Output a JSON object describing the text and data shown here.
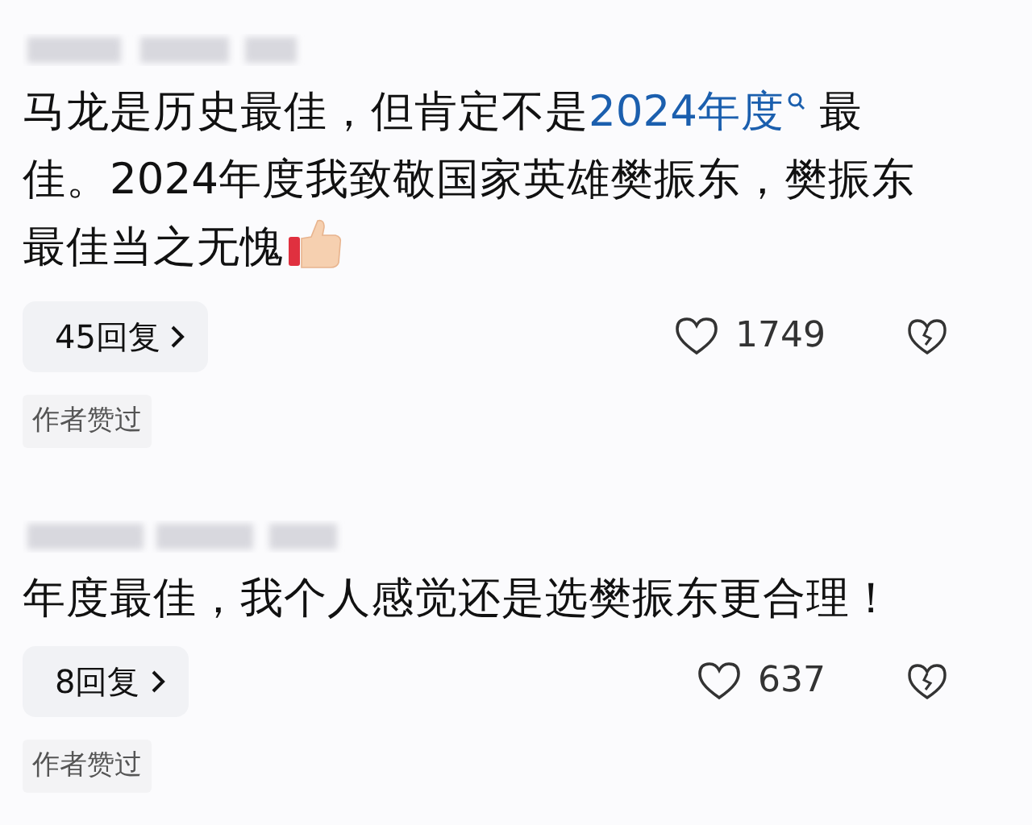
{
  "comments": [
    {
      "text": [
        {
          "kind": "plain",
          "text": "马龙是历史最佳，但肯定不是"
        },
        {
          "kind": "link",
          "text": "2024年度"
        },
        {
          "kind": "plain",
          "text": " 最佳。2024年度我致敬国家英雄樊振东，樊振东最佳当之无愧"
        },
        {
          "kind": "emoji"
        }
      ],
      "replies": "45回复",
      "likes": "1749",
      "tag": "作者赞过"
    },
    {
      "text": [
        {
          "kind": "plain",
          "text": "年度最佳，我个人感觉还是选樊振东更合理！"
        }
      ],
      "replies": "8回复",
      "likes": "637",
      "tag": "作者赞过"
    }
  ]
}
